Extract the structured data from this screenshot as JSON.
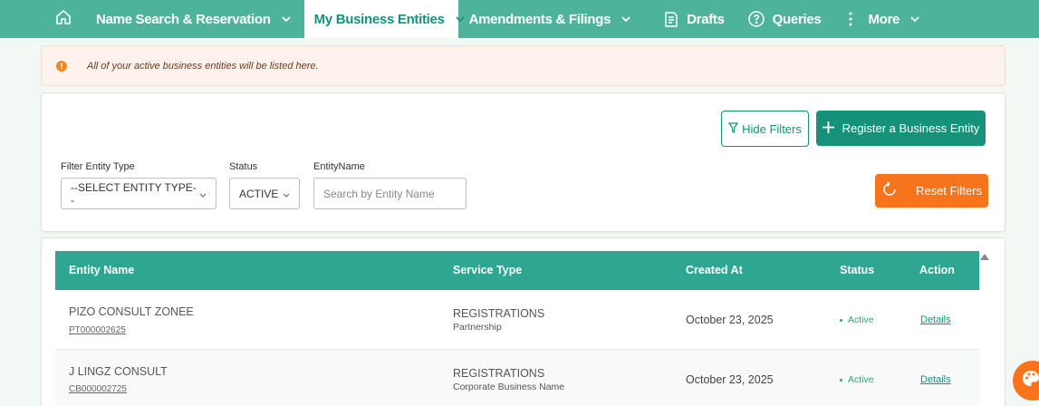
{
  "nav": {
    "home_icon": "home-icon",
    "items": [
      {
        "label": "Name Search & Reservation",
        "dropdown": true
      },
      {
        "label": "My Business Entities",
        "dropdown": true,
        "active": true
      },
      {
        "label": "Amendments & Filings",
        "dropdown": true
      },
      {
        "label": "Drafts",
        "icon": "document-icon"
      },
      {
        "label": "Queries",
        "icon": "question-icon"
      },
      {
        "label": "More",
        "icon": "vertical-dots-icon",
        "dropdown": true
      }
    ]
  },
  "alert": {
    "text": "All of your active business entities will be listed here."
  },
  "filters": {
    "hide_filters_label": "Hide Filters",
    "register_label": "Register a Business Entity",
    "reset_label": "Reset Filters",
    "entity_type": {
      "label": "Filter Entity Type",
      "value": "--SELECT ENTITY TYPE--"
    },
    "status": {
      "label": "Status",
      "value": "ACTIVE"
    },
    "entity_name": {
      "label": "EntityName",
      "placeholder": "Search by Entity Name"
    }
  },
  "table": {
    "headers": {
      "entity_name": "Entity Name",
      "service_type": "Service Type",
      "created_at": "Created At",
      "status": "Status",
      "action": "Action"
    },
    "rows": [
      {
        "name": "PIZO CONSULT ZONEE",
        "id": "PT000002625",
        "service": "REGISTRATIONS",
        "service_sub": "Partnership",
        "created": "October 23, 2025",
        "status": "Active",
        "action": "Details"
      },
      {
        "name": "J LINGZ CONSULT",
        "id": "CB000002725",
        "service": "REGISTRATIONS",
        "service_sub": "Corporate Business Name",
        "created": "October 23, 2025",
        "status": "Active",
        "action": "Details"
      }
    ]
  },
  "colors": {
    "nav_bg": "#4db39a",
    "primary": "#16917a",
    "table_header": "#2ea792",
    "reset_orange": "#f7731c",
    "alert_bg": "#fdf3ec",
    "status_green": "#2ea76c"
  }
}
